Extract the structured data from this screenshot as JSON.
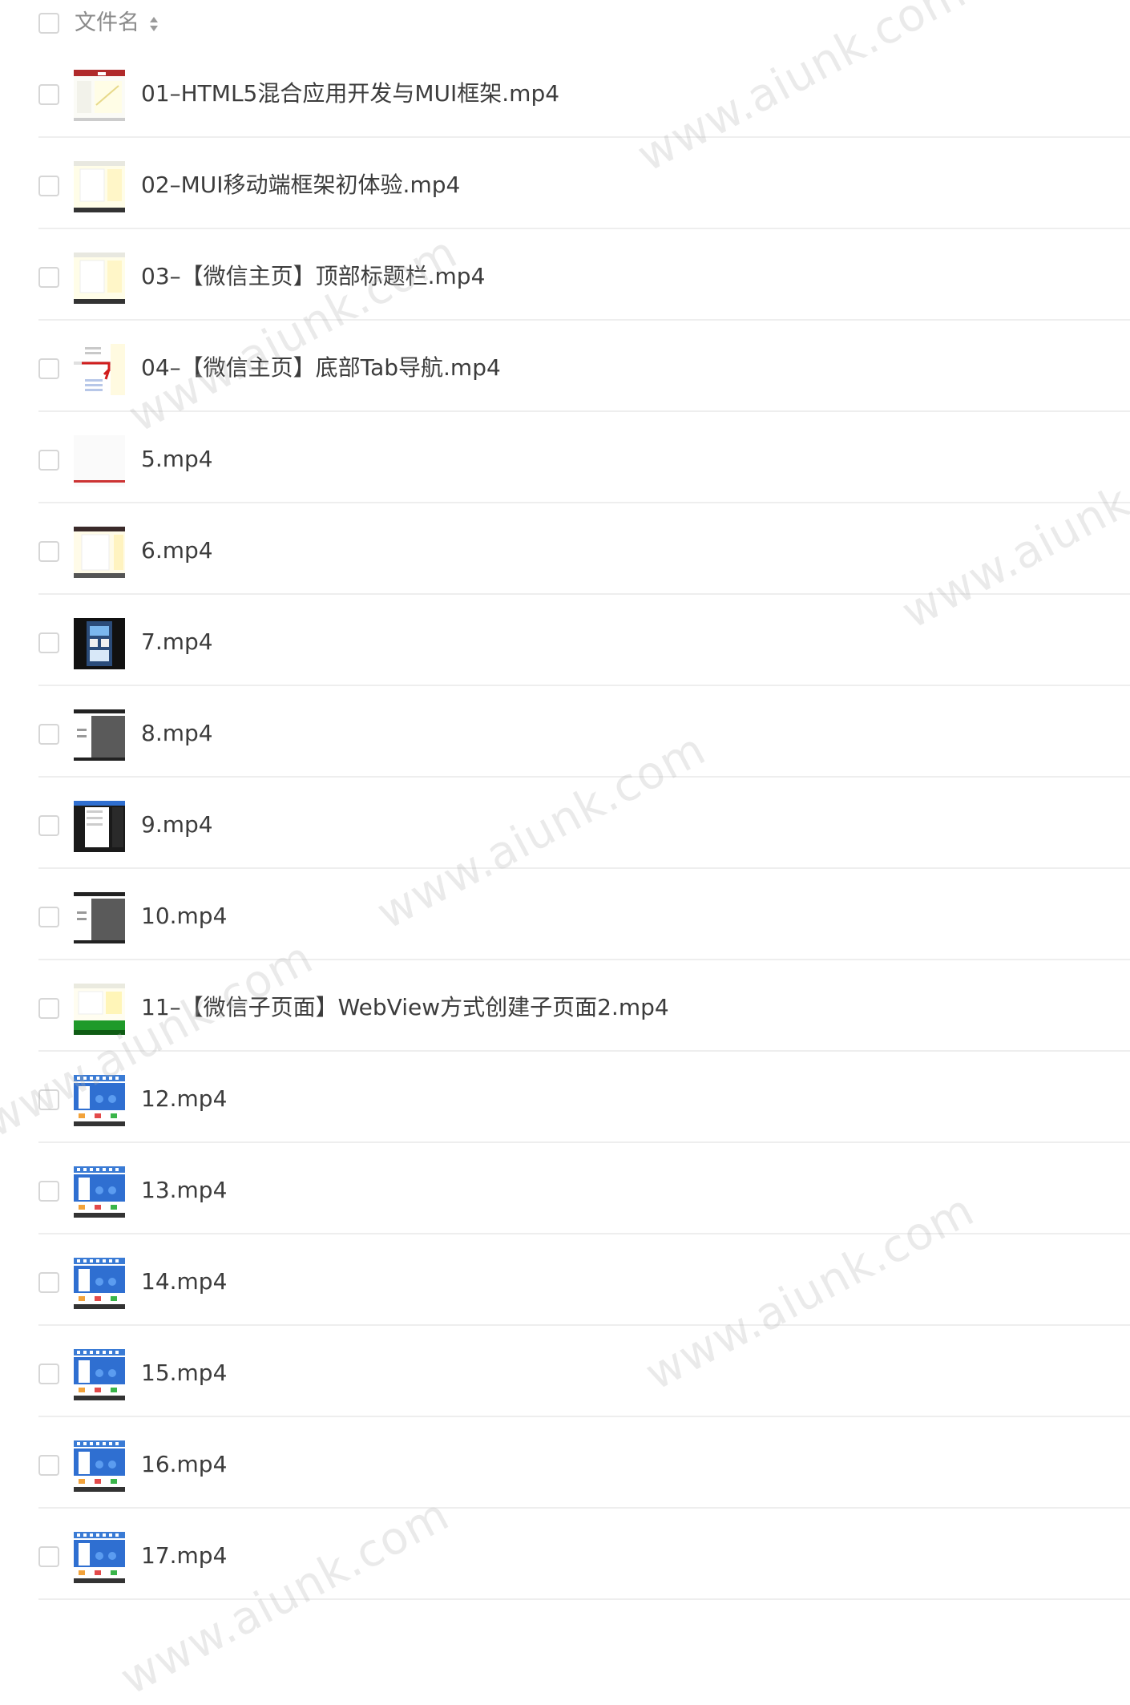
{
  "header": {
    "label": "文件名",
    "sort_icon": "sort-icon"
  },
  "files": [
    {
      "name": "01–HTML5混合应用开发与MUI框架.mp4",
      "thumb_style": "doc-red"
    },
    {
      "name": "02–MUI移动端框架初体验.mp4",
      "thumb_style": "doc-yellow"
    },
    {
      "name": "03–【微信主页】顶部标题栏.mp4",
      "thumb_style": "doc-yellow"
    },
    {
      "name": "04–【微信主页】底部Tab导航.mp4",
      "thumb_style": "doc-list"
    },
    {
      "name": "5.mp4",
      "thumb_style": "blank"
    },
    {
      "name": "6.mp4",
      "thumb_style": "doc-dark-top"
    },
    {
      "name": "7.mp4",
      "thumb_style": "dark-phone"
    },
    {
      "name": "8.mp4",
      "thumb_style": "gray-panel"
    },
    {
      "name": "9.mp4",
      "thumb_style": "dark-phone-blue"
    },
    {
      "name": "10.mp4",
      "thumb_style": "gray-panel"
    },
    {
      "name": "11–【微信子页面】WebView方式创建子页面2.mp4",
      "thumb_style": "doc-green"
    },
    {
      "name": "12.mp4",
      "thumb_style": "blue-app"
    },
    {
      "name": "13.mp4",
      "thumb_style": "blue-app"
    },
    {
      "name": "14.mp4",
      "thumb_style": "blue-app"
    },
    {
      "name": "15.mp4",
      "thumb_style": "blue-app"
    },
    {
      "name": "16.mp4",
      "thumb_style": "blue-app"
    },
    {
      "name": "17.mp4",
      "thumb_style": "blue-app"
    }
  ],
  "watermark": "www.aiunk.com",
  "colors": {
    "text": "#3c3c3c",
    "header_text": "#8a8a8a",
    "divider": "#eeeeee",
    "checkbox_border": "#d6d6d6"
  }
}
